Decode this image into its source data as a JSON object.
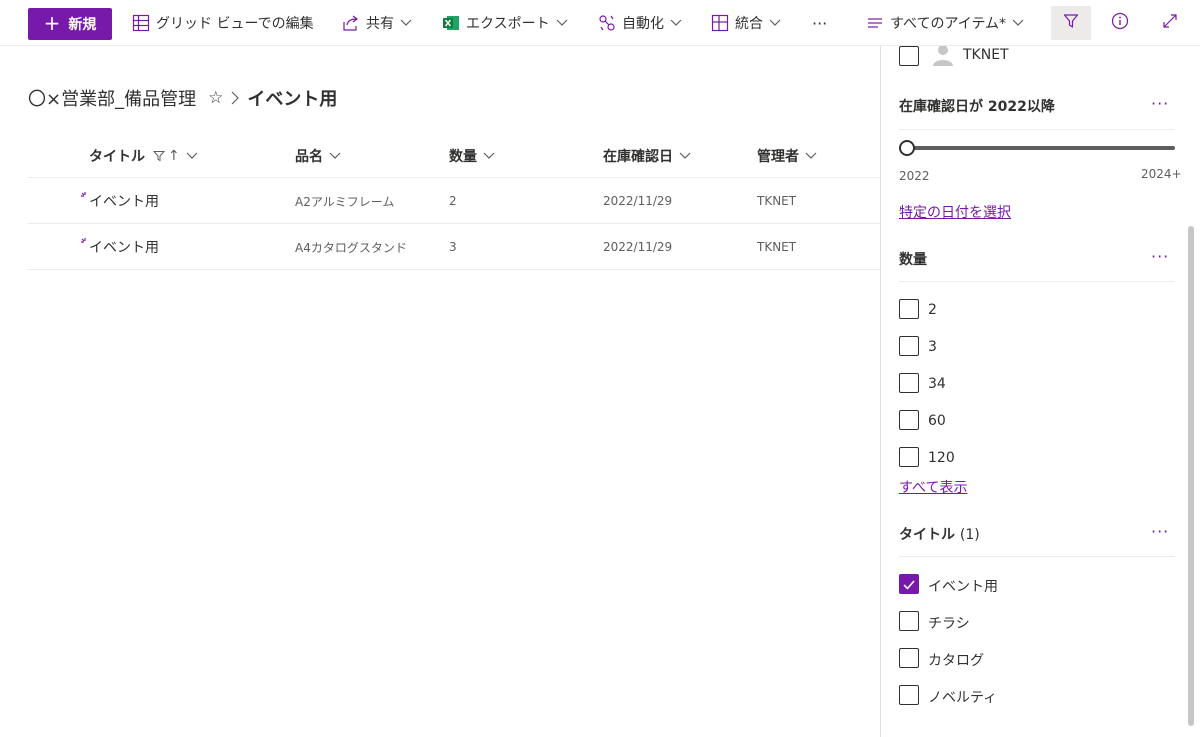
{
  "colors": {
    "accent": "#7719aa",
    "text": "#323130",
    "subtle": "#605e5c"
  },
  "toolbar": {
    "new_label": "新規",
    "grid_edit_label": "グリッド ビューでの編集",
    "share_label": "共有",
    "export_label": "エクスポート",
    "automate_label": "自動化",
    "integrate_label": "統合",
    "more_label": "···",
    "view_label": "すべてのアイテム*"
  },
  "breadcrumb": {
    "parent": "〇×営業部_備品管理",
    "star": "☆",
    "current": "イベント用"
  },
  "table": {
    "columns": [
      "タイトル",
      "品名",
      "数量",
      "在庫確認日",
      "管理者"
    ],
    "rows": [
      {
        "title": "イベント用",
        "item": "A2アルミフレーム",
        "qty": "2",
        "date": "2022/11/29",
        "manager": "TKNET"
      },
      {
        "title": "イベント用",
        "item": "A4カタログスタンド",
        "qty": "3",
        "date": "2022/11/29",
        "manager": "TKNET"
      }
    ]
  },
  "filter_pane": {
    "manager_option": "TKNET",
    "date_section": {
      "title": "在庫確認日が 2022以降",
      "more": "···",
      "min_label": "2022",
      "max_label": "2024+",
      "slider_value": 0,
      "link": "特定の日付を選択"
    },
    "qty_section": {
      "title": "数量",
      "more": "···",
      "options": [
        "2",
        "3",
        "34",
        "60",
        "120"
      ],
      "show_all": "すべて表示"
    },
    "title_section": {
      "title": "タイトル",
      "count": "(1)",
      "more": "···",
      "options": [
        {
          "label": "イベント用",
          "checked": true
        },
        {
          "label": "チラシ",
          "checked": false
        },
        {
          "label": "カタログ",
          "checked": false
        },
        {
          "label": "ノベルティ",
          "checked": false
        }
      ]
    }
  }
}
